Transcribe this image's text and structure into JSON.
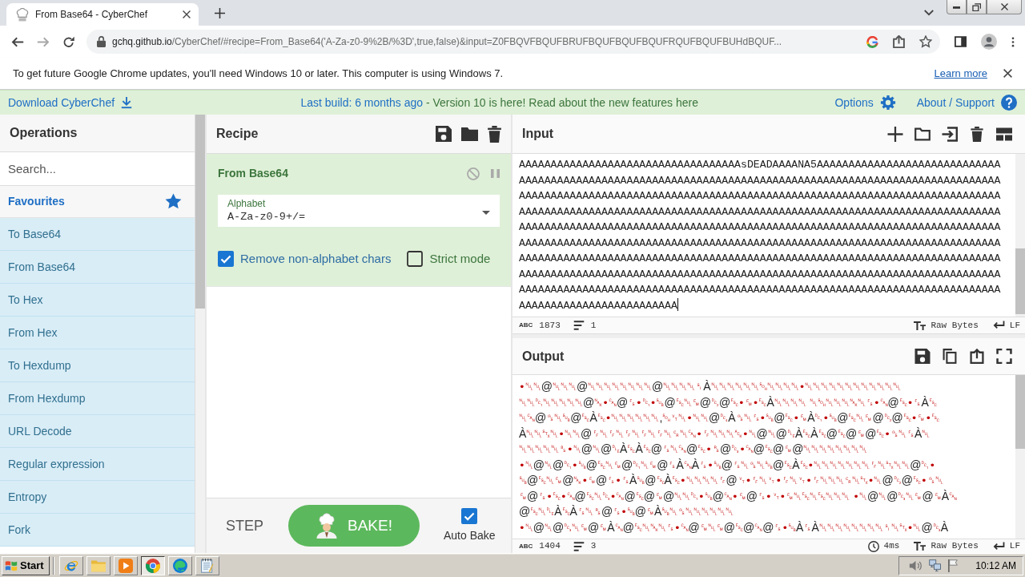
{
  "browser": {
    "tabs": [
      {
        "title": "From Base64 - CyberChef",
        "selected": true
      }
    ],
    "url": {
      "host": "gchq.github.io",
      "rest": "/CyberChef/#recipe=From_Base64('A-Za-z0-9%2B/%3D',true,false)&input=Z0FBQVFBQUFBRUFBQUFBQUFBQUFRQUFBQUFBUHdBQUF..."
    }
  },
  "infobar": {
    "message": "To get future Google Chrome updates, you'll need Windows 10 or later. This computer is using Windows 7.",
    "link": "Learn more"
  },
  "banner": {
    "download": "Download CyberChef",
    "build": "Last build: 6 months ago",
    "notice": "- Version 10 is here! Read about the new features",
    "notice_link": "here",
    "options": "Options",
    "support": "About / Support"
  },
  "operations": {
    "title": "Operations",
    "search": {
      "placeholder": "Search..."
    },
    "favourites": "Favourites",
    "items": [
      "To Base64",
      "From Base64",
      "To Hex",
      "From Hex",
      "To Hexdump",
      "From Hexdump",
      "URL Decode",
      "Regular expression",
      "Entropy",
      "Fork"
    ]
  },
  "recipe": {
    "title": "Recipe",
    "operations": [
      {
        "name": "From Base64",
        "fields": [
          {
            "label": "Alphabet",
            "value": "A-Za-z0-9+/="
          }
        ],
        "options": [
          {
            "label": "Remove non-alphabet chars",
            "checked": true
          },
          {
            "label": "Strict mode",
            "checked": false
          }
        ]
      }
    ]
  },
  "controls": {
    "step": "STEP",
    "bake": "BAKE!",
    "auto_bake": {
      "label": "Auto Bake",
      "checked": true
    }
  },
  "input": {
    "title": "Input",
    "lines": [
      "AAAAAAAAAAAAAAAAAAAAAAAAAAAAAAAAAAAsDEADAAAANA5AAAAAAAAAAAAAAAAAAAAAAAAAAAAA",
      "AAAAAAAAAAAAAAAAAAAAAAAAAAAAAAAAAAAAAAAAAAAAAAAAAAAAAAAAAAAAAAAAAAAAAAAAAAAA",
      "AAAAAAAAAAAAAAAAAAAAAAAAAAAAAAAAAAAAAAAAAAAAAAAAAAAAAAAAAAAAAAAAAAAAAAAAAAAA",
      "AAAAAAAAAAAAAAAAAAAAAAAAAAAAAAAAAAAAAAAAAAAAAAAAAAAAAAAAAAAAAAAAAAAAAAAAAAAA",
      "AAAAAAAAAAAAAAAAAAAAAAAAAAAAAAAAAAAAAAAAAAAAAAAAAAAAAAAAAAAAAAAAAAAAAAAAAAAA",
      "AAAAAAAAAAAAAAAAAAAAAAAAAAAAAAAAAAAAAAAAAAAAAAAAAAAAAAAAAAAAAAAAAAAAAAAAAAAA",
      "AAAAAAAAAAAAAAAAAAAAAAAAAAAAAAAAAAAAAAAAAAAAAAAAAAAAAAAAAAAAAAAAAAAAAAAAAAAA",
      "AAAAAAAAAAAAAAAAAAAAAAAAAAAAAAAAAAAAAAAAAAAAAAAAAAAAAAAAAAAAAAAAAAAAAAAAAAAA",
      "AAAAAAAAAAAAAAAAAAAAAAAAAAAAAAAAAAAAAAAAAAAAAAAAAAAAAAAAAAAAAAAAAAAAAAAAAAAA",
      "AAAAAAAAAAAAAAAAAAAAAAAAA"
    ],
    "status": {
      "chars_label": "ABC",
      "length": "1873",
      "lines": "1",
      "encoding": "Raw Bytes",
      "eol": "LF"
    }
  },
  "output": {
    "title": "Output",
    "lines": [
      [
        {
          "kind": "ctrl",
          "text": "•␀␀"
        },
        {
          "kind": "char",
          "text": "@"
        },
        {
          "kind": "ctrl",
          "text": "␀␀␀"
        },
        {
          "kind": "char",
          "text": "@"
        },
        {
          "kind": "ctrl",
          "text": "␀␀␀␀␀␀␀␀"
        },
        {
          "kind": "char",
          "text": "@"
        },
        {
          "kind": "ctrl",
          "text": "␀␀␀␀␏"
        },
        {
          "kind": "char",
          "text": "À"
        },
        {
          "kind": "ctrl",
          "text": "␀␀␀␀␀␀␁␀␀␀␀•␀␀␀␀␀␀␀␀␀␀␀␀"
        }
      ],
      [
        {
          "kind": "ctrl",
          "text": "␀␀␑␀␀␀␀␀"
        },
        {
          "kind": "char",
          "text": "@"
        },
        {
          "kind": "ctrl",
          "text": "␕•␘"
        },
        {
          "kind": "char",
          "text": "@"
        },
        {
          "kind": "ctrl",
          "text": "␜•␑•␚"
        },
        {
          "kind": "char",
          "text": "@"
        },
        {
          "kind": "ctrl",
          "text": "␛␀␙"
        },
        {
          "kind": "char",
          "text": "@"
        },
        {
          "kind": "ctrl",
          "text": "␒"
        },
        {
          "kind": "char",
          "text": "@"
        },
        {
          "kind": "ctrl",
          "text": "␛•␙•␛"
        },
        {
          "kind": "char",
          "text": "À"
        },
        {
          "kind": "ctrl",
          "text": "␀␀␀␀ ␀␁␀␀␀␕␀␜•␘"
        },
        {
          "kind": "char",
          "text": "@"
        },
        {
          "kind": "ctrl",
          "text": "␛•␜"
        },
        {
          "kind": "char",
          "text": "À"
        },
        {
          "kind": "ctrl",
          "text": "␛"
        }
      ],
      [
        {
          "kind": "ctrl",
          "text": "␀␘"
        },
        {
          "kind": "char",
          "text": "@"
        },
        {
          "kind": "ctrl",
          "text": "␝␀␚"
        },
        {
          "kind": "char",
          "text": "@"
        },
        {
          "kind": "ctrl",
          "text": "␛"
        },
        {
          "kind": "char",
          "text": "À"
        },
        {
          "kind": "ctrl",
          "text": "␛•␀␀␀␀␀␀"
        },
        {
          "kind": "char",
          "text": ","
        },
        {
          "kind": "ctrl",
          "text": "␁␋␀•␀␀"
        },
        {
          "kind": "char",
          "text": "@"
        },
        {
          "kind": "ctrl",
          "text": "␔"
        },
        {
          "kind": "char",
          "text": "À"
        },
        {
          "kind": "ctrl",
          "text": "␝␀␜•␚"
        },
        {
          "kind": "char",
          "text": "@"
        },
        {
          "kind": "ctrl",
          "text": "␛•␙"
        },
        {
          "kind": "char",
          "text": "À"
        },
        {
          "kind": "ctrl",
          "text": "␑•␚"
        },
        {
          "kind": "char",
          "text": "@"
        },
        {
          "kind": "ctrl",
          "text": "␛␀␙"
        },
        {
          "kind": "char",
          "text": "@"
        },
        {
          "kind": "ctrl",
          "text": "␒"
        },
        {
          "kind": "char",
          "text": "@"
        },
        {
          "kind": "ctrl",
          "text": "␛•␙•␛"
        }
      ],
      [
        {
          "kind": "char",
          "text": "À"
        },
        {
          "kind": "ctrl",
          "text": "␀␀␂␀•␀␀"
        },
        {
          "kind": "char",
          "text": "@"
        },
        {
          "kind": "ctrl",
          "text": "␌␀␌␀␌␀␌␀␌␀␍␀␘•␌␀␀␀␆•␀"
        },
        {
          "kind": "char",
          "text": "@"
        },
        {
          "kind": "ctrl",
          "text": "␀"
        },
        {
          "kind": "char",
          "text": "@"
        },
        {
          "kind": "ctrl",
          "text": "␐"
        },
        {
          "kind": "char",
          "text": "À"
        },
        {
          "kind": "ctrl",
          "text": "␛"
        },
        {
          "kind": "char",
          "text": "À"
        },
        {
          "kind": "ctrl",
          "text": "␛"
        },
        {
          "kind": "char",
          "text": "@"
        },
        {
          "kind": "ctrl",
          "text": "␛"
        },
        {
          "kind": "char",
          "text": "@"
        },
        {
          "kind": "ctrl",
          "text": "␙"
        },
        {
          "kind": "char",
          "text": "@"
        },
        {
          "kind": "ctrl",
          "text": "␛•␝␀␜"
        },
        {
          "kind": "char",
          "text": "À"
        },
        {
          "kind": "ctrl",
          "text": "␀"
        }
      ],
      [
        {
          "kind": "ctrl",
          "text": "␀␀␀␀␀␈•␀"
        },
        {
          "kind": "char",
          "text": "@"
        },
        {
          "kind": "ctrl",
          "text": "␀"
        },
        {
          "kind": "char",
          "text": "@"
        },
        {
          "kind": "ctrl",
          "text": "␐"
        },
        {
          "kind": "char",
          "text": "À"
        },
        {
          "kind": "ctrl",
          "text": "␛"
        },
        {
          "kind": "char",
          "text": "À"
        },
        {
          "kind": "ctrl",
          "text": "␛"
        },
        {
          "kind": "char",
          "text": "@"
        },
        {
          "kind": "ctrl",
          "text": "␜␀␘"
        },
        {
          "kind": "char",
          "text": "@"
        },
        {
          "kind": "ctrl",
          "text": "␛•␞"
        },
        {
          "kind": "char",
          "text": "@"
        },
        {
          "kind": "ctrl",
          "text": "␓•␘"
        },
        {
          "kind": "char",
          "text": "@"
        },
        {
          "kind": "ctrl",
          "text": "␛"
        },
        {
          "kind": "char",
          "text": "@"
        },
        {
          "kind": "ctrl",
          "text": "␙"
        },
        {
          "kind": "char",
          "text": "@"
        },
        {
          "kind": "ctrl",
          "text": "␀␀␀␀␀␀␀␀"
        }
      ],
      [
        {
          "kind": "ctrl",
          "text": "•␀"
        },
        {
          "kind": "char",
          "text": "@"
        },
        {
          "kind": "ctrl",
          "text": "␀"
        },
        {
          "kind": "char",
          "text": "@"
        },
        {
          "kind": "ctrl",
          "text": "␑•␚"
        },
        {
          "kind": "char",
          "text": "@"
        },
        {
          "kind": "ctrl",
          "text": "␛␀␙"
        },
        {
          "kind": "char",
          "text": "@"
        },
        {
          "kind": "ctrl",
          "text": "␑␀␙"
        },
        {
          "kind": "char",
          "text": "@"
        },
        {
          "kind": "ctrl",
          "text": "␜"
        },
        {
          "kind": "char",
          "text": "À"
        },
        {
          "kind": "ctrl",
          "text": "␘"
        },
        {
          "kind": "char",
          "text": "À"
        },
        {
          "kind": "ctrl",
          "text": "␜•␚"
        },
        {
          "kind": "char",
          "text": "@"
        },
        {
          "kind": "ctrl",
          "text": "␜␀␝␀␚"
        },
        {
          "kind": "char",
          "text": "@"
        },
        {
          "kind": "ctrl",
          "text": "␛"
        },
        {
          "kind": "char",
          "text": "À"
        },
        {
          "kind": "ctrl",
          "text": "␛•␀␀␀␀␀␀␀␌␀␂␀␀"
        },
        {
          "kind": "char",
          "text": "@"
        },
        {
          "kind": "ctrl",
          "text": "␑•"
        }
      ],
      [
        {
          "kind": "ctrl",
          "text": "␚"
        },
        {
          "kind": "char",
          "text": "@"
        },
        {
          "kind": "ctrl",
          "text": "␛␀␙"
        },
        {
          "kind": "char",
          "text": "@"
        },
        {
          "kind": "ctrl",
          "text": "␕•␙"
        },
        {
          "kind": "char",
          "text": "@"
        },
        {
          "kind": "ctrl",
          "text": "␜•␜"
        },
        {
          "kind": "char",
          "text": "À"
        },
        {
          "kind": "ctrl",
          "text": "␚"
        },
        {
          "kind": "char",
          "text": "@"
        },
        {
          "kind": "ctrl",
          "text": "␛"
        },
        {
          "kind": "char",
          "text": "À"
        },
        {
          "kind": "ctrl",
          "text": "␛•␀␀␀␀␌"
        },
        {
          "kind": "char",
          "text": "@"
        },
        {
          "kind": "ctrl",
          "text": "␋•␌␀␋•␌␀␋•␌␀␀␀␍␀␂•␀"
        },
        {
          "kind": "char",
          "text": "@"
        },
        {
          "kind": "ctrl",
          "text": "␒"
        },
        {
          "kind": "char",
          "text": "@"
        },
        {
          "kind": "ctrl",
          "text": "␛•␝␀"
        }
      ],
      [
        {
          "kind": "ctrl",
          "text": "␙"
        },
        {
          "kind": "char",
          "text": "@"
        },
        {
          "kind": "ctrl",
          "text": "␜•␛•␘"
        },
        {
          "kind": "char",
          "text": "@"
        },
        {
          "kind": "ctrl",
          "text": "␛␀␓•␘"
        },
        {
          "kind": "char",
          "text": "@"
        },
        {
          "kind": "ctrl",
          "text": "␛"
        },
        {
          "kind": "char",
          "text": "@"
        },
        {
          "kind": "ctrl",
          "text": "␙"
        },
        {
          "kind": "char",
          "text": "@"
        },
        {
          "kind": "ctrl",
          "text": "␀␀␑•␚"
        },
        {
          "kind": "char",
          "text": "@"
        },
        {
          "kind": "ctrl",
          "text": "␘•␙"
        },
        {
          "kind": "char",
          "text": "@"
        },
        {
          "kind": "ctrl",
          "text": "␜•␋•␙␀␛␀␛␀␀␀ •␀"
        },
        {
          "kind": "char",
          "text": "@"
        },
        {
          "kind": "ctrl",
          "text": "␀"
        },
        {
          "kind": "char",
          "text": "@"
        },
        {
          "kind": "ctrl",
          "text": "␓␀␙"
        },
        {
          "kind": "char",
          "text": "@"
        },
        {
          "kind": "ctrl",
          "text": "␙"
        },
        {
          "kind": "char",
          "text": "À"
        },
        {
          "kind": "ctrl",
          "text": "␘"
        }
      ],
      [
        {
          "kind": "char",
          "text": "@"
        },
        {
          "kind": "ctrl",
          "text": "␛␀␐"
        },
        {
          "kind": "char",
          "text": "À"
        },
        {
          "kind": "ctrl",
          "text": "␛"
        },
        {
          "kind": "char",
          "text": "À"
        },
        {
          "kind": "ctrl",
          "text": "␜␀␞"
        },
        {
          "kind": "char",
          "text": "@"
        },
        {
          "kind": "ctrl",
          "text": "␜•␚"
        },
        {
          "kind": "char",
          "text": "@"
        },
        {
          "kind": "ctrl",
          "text": "␙"
        },
        {
          "kind": "char",
          "text": "À"
        },
        {
          "kind": "ctrl",
          "text": "␚␀␝␀␀␀␀␀␀"
        }
      ],
      [
        {
          "kind": "ctrl",
          "text": "•␀"
        },
        {
          "kind": "char",
          "text": "@"
        },
        {
          "kind": "ctrl",
          "text": "␀"
        },
        {
          "kind": "char",
          "text": "@"
        },
        {
          "kind": "ctrl",
          "text": "␓␀␙"
        },
        {
          "kind": "char",
          "text": "@"
        },
        {
          "kind": "ctrl",
          "text": "␙"
        },
        {
          "kind": "char",
          "text": "À"
        },
        {
          "kind": "ctrl",
          "text": "␘"
        },
        {
          "kind": "char",
          "text": "@"
        },
        {
          "kind": "ctrl",
          "text": "␛␀␕␀␜•␘"
        },
        {
          "kind": "char",
          "text": "@"
        },
        {
          "kind": "ctrl",
          "text": "␙␀␙"
        },
        {
          "kind": "char",
          "text": "@"
        },
        {
          "kind": "ctrl",
          "text": "␛"
        },
        {
          "kind": "char",
          "text": "@"
        },
        {
          "kind": "ctrl",
          "text": "␘"
        },
        {
          "kind": "char",
          "text": "@"
        },
        {
          "kind": "ctrl",
          "text": "␜•␚"
        },
        {
          "kind": "char",
          "text": "À"
        },
        {
          "kind": "ctrl",
          "text": "␜"
        },
        {
          "kind": "char",
          "text": "À"
        },
        {
          "kind": "ctrl",
          "text": "␀␀␀␀␀␀␀␀␏␀␂•␀"
        },
        {
          "kind": "char",
          "text": "@"
        },
        {
          "kind": "ctrl",
          "text": "␓"
        },
        {
          "kind": "char",
          "text": "À"
        }
      ]
    ],
    "status": {
      "chars_label": "ABC",
      "length": "1404",
      "lines": "3",
      "time": "4ms",
      "encoding": "Raw Bytes",
      "eol": "LF"
    }
  },
  "taskbar": {
    "start": "Start",
    "apps": [
      {
        "kind": "ie",
        "selected": false
      },
      {
        "kind": "folder",
        "selected": false
      },
      {
        "kind": "media",
        "selected": false
      },
      {
        "kind": "chrome",
        "selected": true
      },
      {
        "kind": "edge",
        "selected": false
      },
      {
        "kind": "notepad",
        "selected": false
      }
    ],
    "clock": "10:12 AM"
  }
}
